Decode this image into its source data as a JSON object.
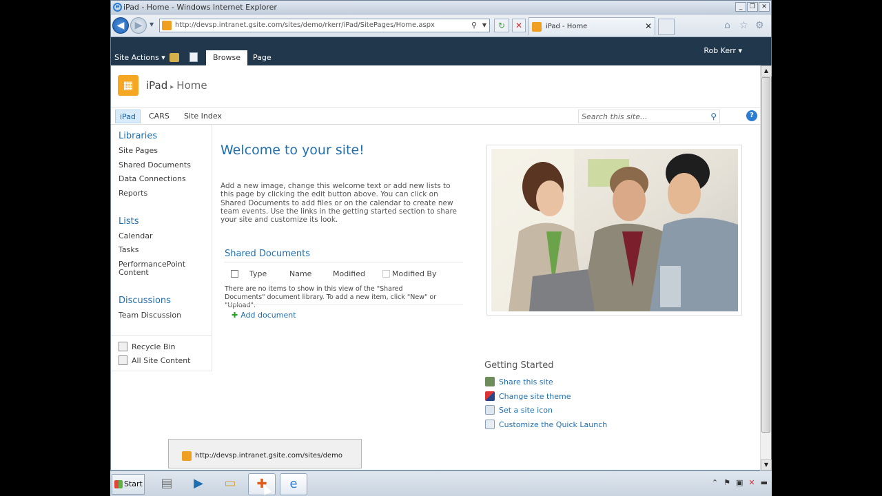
{
  "window": {
    "title": "iPad - Home - Windows Internet Explorer",
    "url": "http://devsp.intranet.gsite.com/sites/demo/rkerr/iPad/SitePages/Home.aspx",
    "tab_title": "iPad - Home"
  },
  "ribbon": {
    "site_actions": "Site Actions",
    "tabs": [
      {
        "label": "Browse"
      },
      {
        "label": "Page"
      }
    ],
    "user": "Rob Kerr"
  },
  "site": {
    "name": "iPad",
    "page": "Home"
  },
  "topnav": {
    "items": [
      {
        "label": "iPad"
      },
      {
        "label": "CARS"
      },
      {
        "label": "Site Index"
      }
    ],
    "search_placeholder": "Search this site..."
  },
  "quicklaunch": {
    "libraries_heading": "Libraries",
    "libraries": [
      "Site Pages",
      "Shared Documents",
      "Data Connections",
      "Reports"
    ],
    "lists_heading": "Lists",
    "lists": [
      "Calendar",
      "Tasks",
      "PerformancePoint Content"
    ],
    "discussions_heading": "Discussions",
    "discussions": [
      "Team Discussion"
    ],
    "footer": [
      "Recycle Bin",
      "All Site Content"
    ]
  },
  "main": {
    "welcome": "Welcome to your site!",
    "intro": "Add a new image, change this welcome text or add new lists to this page by clicking the edit button above. You can click on Shared Documents to add files or on the calendar to create new team events. Use the links in the getting started section to share your site and customize its look.",
    "shared_docs": {
      "title": "Shared Documents",
      "columns": [
        "Type",
        "Name",
        "Modified",
        "Modified By"
      ],
      "empty_text": "There are no items to show in this view of the \"Shared Documents\" document library. To add a new item, click \"New\" or \"Upload\".",
      "add_label": "Add document"
    },
    "getting_started": {
      "heading": "Getting Started",
      "items": [
        "Share this site",
        "Change site theme",
        "Set a site icon",
        "Customize the Quick Launch"
      ]
    }
  },
  "status_tooltip": {
    "url": "http://devsp.intranet.gsite.com/sites/demo"
  },
  "taskbar": {
    "start_label": "Start"
  },
  "colors": {
    "ribbon_bg": "#21374c",
    "link_blue": "#1f6fb0",
    "site_logo": "#f5a623"
  }
}
